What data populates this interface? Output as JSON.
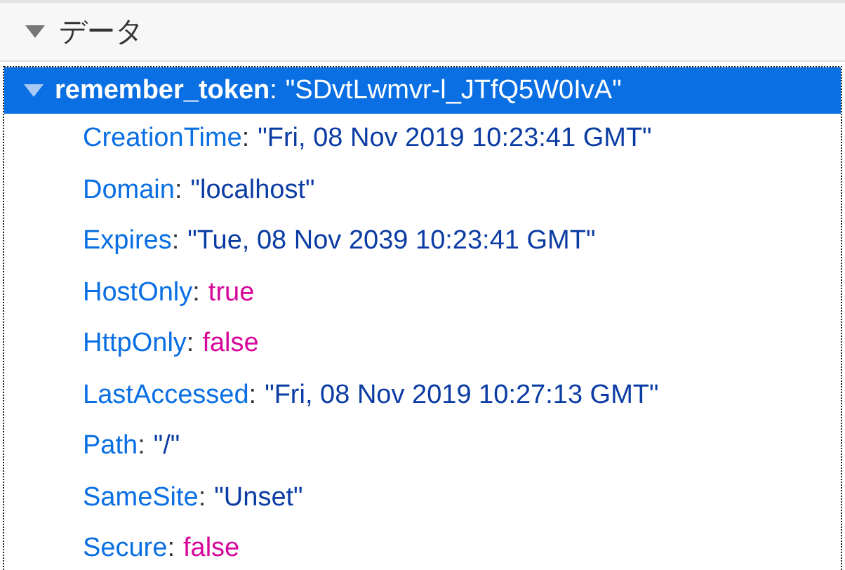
{
  "section": {
    "title": "データ",
    "expanded": true
  },
  "separator": ":",
  "entry": {
    "key": "remember_token",
    "value": "\"SDvtLwmvr-l_JTfQ5W0IvA\"",
    "expanded": true,
    "selected": true,
    "children": [
      {
        "key": "CreationTime",
        "value": "\"Fri, 08 Nov 2019 10:23:41 GMT\"",
        "kind": "string"
      },
      {
        "key": "Domain",
        "value": "\"localhost\"",
        "kind": "string"
      },
      {
        "key": "Expires",
        "value": "\"Tue, 08 Nov 2039 10:23:41 GMT\"",
        "kind": "string"
      },
      {
        "key": "HostOnly",
        "value": "true",
        "kind": "boolean"
      },
      {
        "key": "HttpOnly",
        "value": "false",
        "kind": "boolean"
      },
      {
        "key": "LastAccessed",
        "value": "\"Fri, 08 Nov 2019 10:27:13 GMT\"",
        "kind": "string"
      },
      {
        "key": "Path",
        "value": "\"/\"",
        "kind": "string"
      },
      {
        "key": "SameSite",
        "value": "\"Unset\"",
        "kind": "string"
      },
      {
        "key": "Secure",
        "value": "false",
        "kind": "boolean"
      }
    ]
  }
}
